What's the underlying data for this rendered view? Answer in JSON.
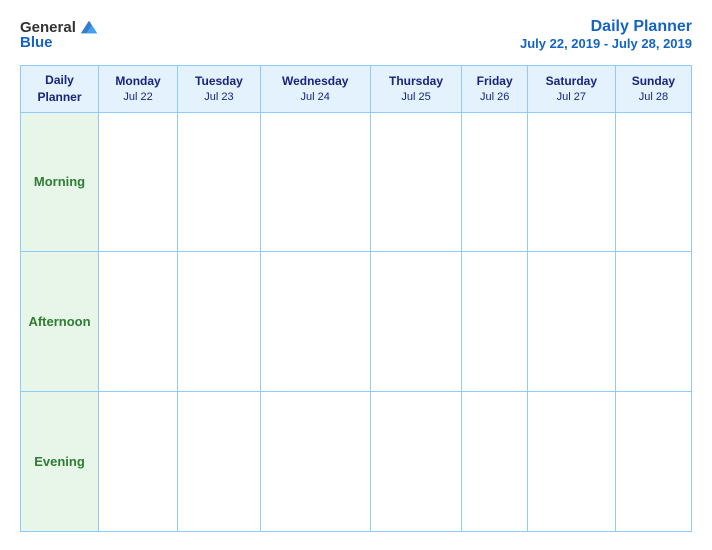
{
  "header": {
    "logo_general": "General",
    "logo_blue": "Blue",
    "title": "Daily Planner",
    "dates": "July 22, 2019 - July 28, 2019"
  },
  "table": {
    "header_col": {
      "label1": "Daily",
      "label2": "Planner"
    },
    "columns": [
      {
        "day": "Monday",
        "date": "Jul 22"
      },
      {
        "day": "Tuesday",
        "date": "Jul 23"
      },
      {
        "day": "Wednesday",
        "date": "Jul 24"
      },
      {
        "day": "Thursday",
        "date": "Jul 25"
      },
      {
        "day": "Friday",
        "date": "Jul 26"
      },
      {
        "day": "Saturday",
        "date": "Jul 27"
      },
      {
        "day": "Sunday",
        "date": "Jul 28"
      }
    ],
    "rows": [
      {
        "label": "Morning"
      },
      {
        "label": "Afternoon"
      },
      {
        "label": "Evening"
      }
    ]
  }
}
